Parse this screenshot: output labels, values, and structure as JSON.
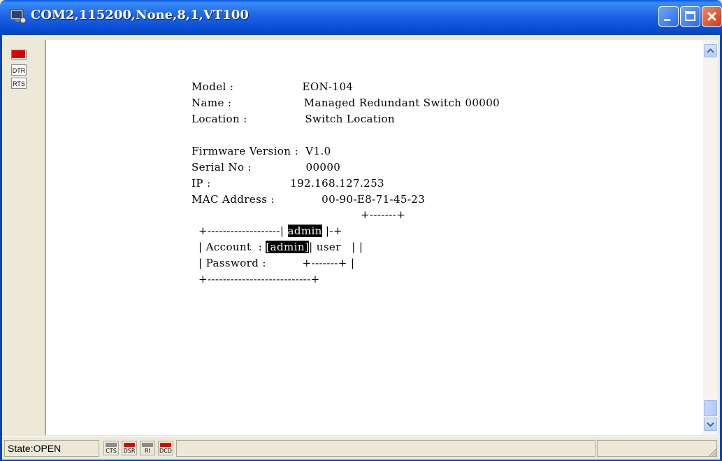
{
  "window": {
    "title": "COM2,115200,None,8,1,VT100"
  },
  "left_panel": {
    "dtr_label": "DTR",
    "rts_label": "RTS"
  },
  "terminal": {
    "lines": [
      "Model :                   EON-104",
      "Name :                    Managed Redundant Switch 00000",
      "Location :                Switch Location",
      "Firmware Version :  V1.0",
      "Serial No :               00000",
      "IP :                      192.168.127.253",
      "MAC Address :             00-90-E8-71-45-23"
    ],
    "dialog": {
      "top_border": "+-------+",
      "row1_prefix": "+-------------------| ",
      "row1_selected": "admin",
      "row1_suffix": " |-+",
      "row2_prefix": "| Account  : ",
      "row2_value": "[admin]",
      "row2_suffix": "| user   | |",
      "row3": "| Password :          +-------+ |",
      "bottom_border": "+---------------------------+"
    }
  },
  "status_bar": {
    "state": "State:OPEN",
    "indicators": [
      {
        "label": "CTS",
        "color": "#8C8C8C"
      },
      {
        "label": "DSR",
        "color": "#E00000"
      },
      {
        "label": "RI",
        "color": "#8C8C8C"
      },
      {
        "label": "DCD",
        "color": "#E00000"
      }
    ]
  }
}
